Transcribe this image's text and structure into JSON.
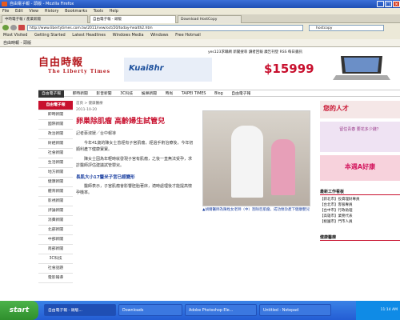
{
  "window": {
    "title": "自由電子報 - 頭版 - Mozilla Firefox",
    "min": "_",
    "max": "□",
    "close": "×"
  },
  "menu": [
    "File",
    "Edit",
    "View",
    "History",
    "Bookmarks",
    "Tools",
    "Help"
  ],
  "browser_tabs": [
    {
      "label": "中時電子報 / 產業新聞",
      "active": false
    },
    {
      "label": "自由電子報 - 頭版",
      "active": true
    },
    {
      "label": "Download HostCopy",
      "active": false
    }
  ],
  "url": "http://www.libertytimes.com.tw/2011/new/oct/20/today-health2.htm",
  "search_placeholder": "hostcopy",
  "bookmarks": [
    "Most Visited",
    "Getting Started",
    "Latest Headlines",
    "Windows Media",
    "Windows",
    "Free Hotmail",
    "自由時報"
  ],
  "tab2": "自由時報 - 頭版",
  "site": {
    "logo_cn": "自由時報",
    "logo_en": "The Liberty Times",
    "ad_kuai": "Kuai8hr",
    "price": "$15999",
    "top_links": [
      "yes123求職網",
      "新聞搜尋",
      "讀者回報",
      "廣告刊登",
      "RSS",
      "每日書訊"
    ]
  },
  "nav": [
    {
      "label": "自由電子報",
      "sel": true
    },
    {
      "label": "即時新聞",
      "sel": false
    },
    {
      "label": "影音新聞",
      "sel": false
    },
    {
      "label": "3C科技",
      "sel": false
    },
    {
      "label": "娛樂新聞",
      "sel": false
    },
    {
      "label": "時尚",
      "sel": false
    },
    {
      "label": "TAIPEI TIMES",
      "sel": false
    },
    {
      "label": "Blog",
      "sel": false
    },
    {
      "label": "自由電子報",
      "sel": false
    }
  ],
  "sidebar": [
    "自由電子報",
    "即時新聞",
    "國際新聞",
    "政治新聞",
    "財經新聞",
    "社會新聞",
    "生活新聞",
    "地方新聞",
    "健康新聞",
    "體育新聞",
    "影視新聞",
    "評論新聞",
    "消費新聞",
    "北部新聞",
    "中部新聞",
    "南部新聞",
    "3C科技",
    "社會話題",
    "電影報導"
  ],
  "breadcrumb": "首頁 > 健康醫療",
  "article": {
    "date": "2011-10-20",
    "title": "卵巢除肌瘤 高齡婦生試管兒",
    "byline": "記者蔡淑媛／台中報導",
    "paras": [
      "今年41歲的陳女士曾經有子宮肌瘤，經過手術治療後，今年初順利產下健康寶寶。",
      "陳女士因為年輕時就發現子宮有肌瘤，之後一直無法受孕，求診醫師評估建議試管嬰兒。",
      "長肌大小17釐米子宮已經變形",
      "醫師表示，子宮肌瘤會影響胚胎著床，適時處理後才能提高懷孕機率。"
    ],
    "caption": "▲胡爾醫師為陳姓女老師（中）割除巨肌瘤，成功懷孕產下健康嬰兒"
  },
  "right": {
    "ad1": "您的人才",
    "ad2": "留住青春 要花多少錢？",
    "ad3": "本週A好康",
    "list_title": "最新工作看板",
    "items": [
      "【新北市】投資理財專員",
      "【台北市】客服專員",
      "【台中市】行政助理",
      "【高雄市】業務代表",
      "【桃園市】門市人員"
    ],
    "health": "健康醫療"
  },
  "taskbar": {
    "start": "start",
    "items": [
      "自由電子報 - 頭版...",
      "Downloads",
      "Adobe Photoshop Ele...",
      "Untitled - Notepad"
    ],
    "time": "11:14 AM"
  }
}
